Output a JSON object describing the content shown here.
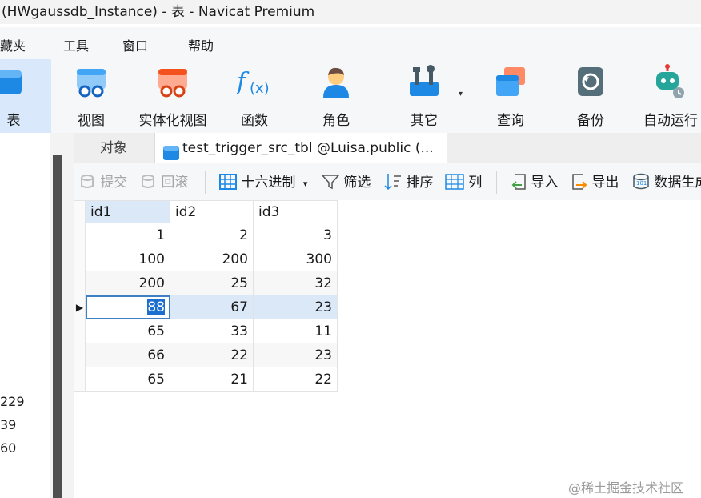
{
  "window": {
    "title": "(HWgaussdb_Instance) - 表 - Navicat Premium"
  },
  "menu": {
    "items": [
      "藏夹",
      "工具",
      "窗口",
      "帮助"
    ]
  },
  "ribbon": {
    "buttons": [
      {
        "label": "表",
        "icon": "table-icon"
      },
      {
        "label": "视图",
        "icon": "view-icon"
      },
      {
        "label": "实体化视图",
        "icon": "materialized-view-icon"
      },
      {
        "label": "函数",
        "icon": "function-icon"
      },
      {
        "label": "角色",
        "icon": "role-icon"
      },
      {
        "label": "其它",
        "icon": "others-icon"
      },
      {
        "label": "查询",
        "icon": "query-icon"
      },
      {
        "label": "备份",
        "icon": "backup-icon"
      },
      {
        "label": "自动运行",
        "icon": "automation-icon"
      }
    ],
    "dropdown_glyph": "▾"
  },
  "left_panel": {
    "numbers": [
      "229",
      "39",
      "60"
    ]
  },
  "tabs": {
    "objects": "对象",
    "active": "test_trigger_src_tbl @Luisa.public (..."
  },
  "toolbar": {
    "commit": "提交",
    "rollback": "回滚",
    "hex": "十六进制",
    "filter": "筛选",
    "sort": "排序",
    "columns": "列",
    "import": "导入",
    "export": "导出",
    "data_gen": "数据生成"
  },
  "table": {
    "columns": [
      "id1",
      "id2",
      "id3"
    ],
    "rows": [
      [
        "1",
        "2",
        "3"
      ],
      [
        "100",
        "200",
        "300"
      ],
      [
        "200",
        "25",
        "32"
      ],
      [
        "88",
        "67",
        "23"
      ],
      [
        "65",
        "33",
        "11"
      ],
      [
        "66",
        "22",
        "23"
      ],
      [
        "65",
        "21",
        "22"
      ]
    ],
    "selected_row_marker": "▶"
  },
  "watermark": "@稀土掘金技术社区",
  "colors": {
    "accent": "#1d6fcf",
    "selection": "#dbe8f8",
    "ribbon_active": "#d9e9fb"
  }
}
